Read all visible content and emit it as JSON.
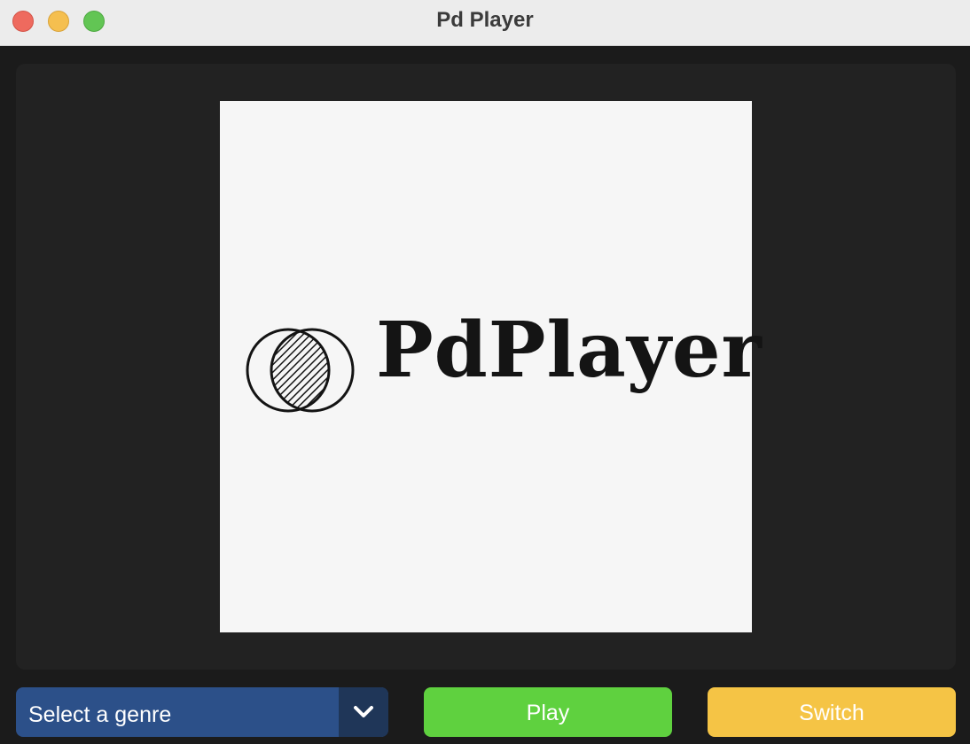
{
  "window": {
    "title": "Pd Player"
  },
  "artwork": {
    "logo_text": "PdPlayer",
    "logo_icon": "two-overlapping-circles-icon"
  },
  "controls": {
    "genre_select": {
      "selected": "Select a genre",
      "icon": "chevron-down-icon"
    },
    "play_label": "Play",
    "switch_label": "Switch"
  },
  "colors": {
    "titlebar": "#ececec",
    "panel": "#222222",
    "genre_select": "#2c5089",
    "play_button": "#5fd13f",
    "switch_button": "#f5c445"
  }
}
